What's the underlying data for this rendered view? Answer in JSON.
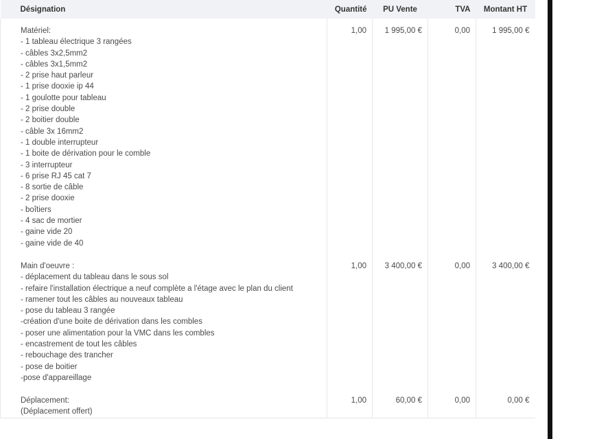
{
  "table": {
    "headers": {
      "designation": "Désignation",
      "quantite": "Quantité",
      "pu_vente": "PU Vente",
      "tva": "TVA",
      "montant_ht": "Montant HT"
    },
    "rows": [
      {
        "lines": [
          "Matériel:",
          "- 1 tableau électrique 3 rangées",
          "- câbles 3x2,5mm2",
          "- câbles 3x1,5mm2",
          "- 2 prise haut parleur",
          "- 1 prise dooxie ip 44",
          "- 1 goulotte pour tableau",
          "- 2 prise double",
          "- 2 boitier double",
          "- câble 3x 16mm2",
          "- 1 double interrupteur",
          "- 1 boite de dérivation pour le comble",
          "- 3 interrupteur",
          "- 6 prise RJ 45 cat 7",
          "- 8 sortie de câble",
          "- 2 prise dooxie",
          "- boîtiers",
          "- 4 sac de mortier",
          "- gaine vide 20",
          "- gaine vide de 40"
        ],
        "quantite": "1,00",
        "pu_vente": "1 995,00 €",
        "tva": "0,00",
        "montant_ht": "1 995,00 €"
      },
      {
        "lines": [
          "Main d'oeuvre :",
          "- déplacement du tableau dans le sous sol",
          "- refaire l'installation électrique a neuf complète a l'étage avec le plan du client",
          "- ramener tout les câbles au nouveaux tableau",
          "- pose du tableau 3 rangée",
          "-création d'une boite de dérivation dans les combles",
          "- poser une alimentation pour la VMC dans les combles",
          "- encastrement de tout les câbles",
          "- rebouchage des trancher",
          "- pose de boitier",
          "-pose d'appareillage"
        ],
        "quantite": "1,00",
        "pu_vente": "3 400,00 €",
        "tva": "0,00",
        "montant_ht": "3 400,00 €"
      },
      {
        "lines": [
          "Déplacement:",
          "(Déplacement offert)"
        ],
        "quantite": "1,00",
        "pu_vente": "60,00 €",
        "tva": "0,00",
        "montant_ht": "0,00 €"
      }
    ]
  }
}
